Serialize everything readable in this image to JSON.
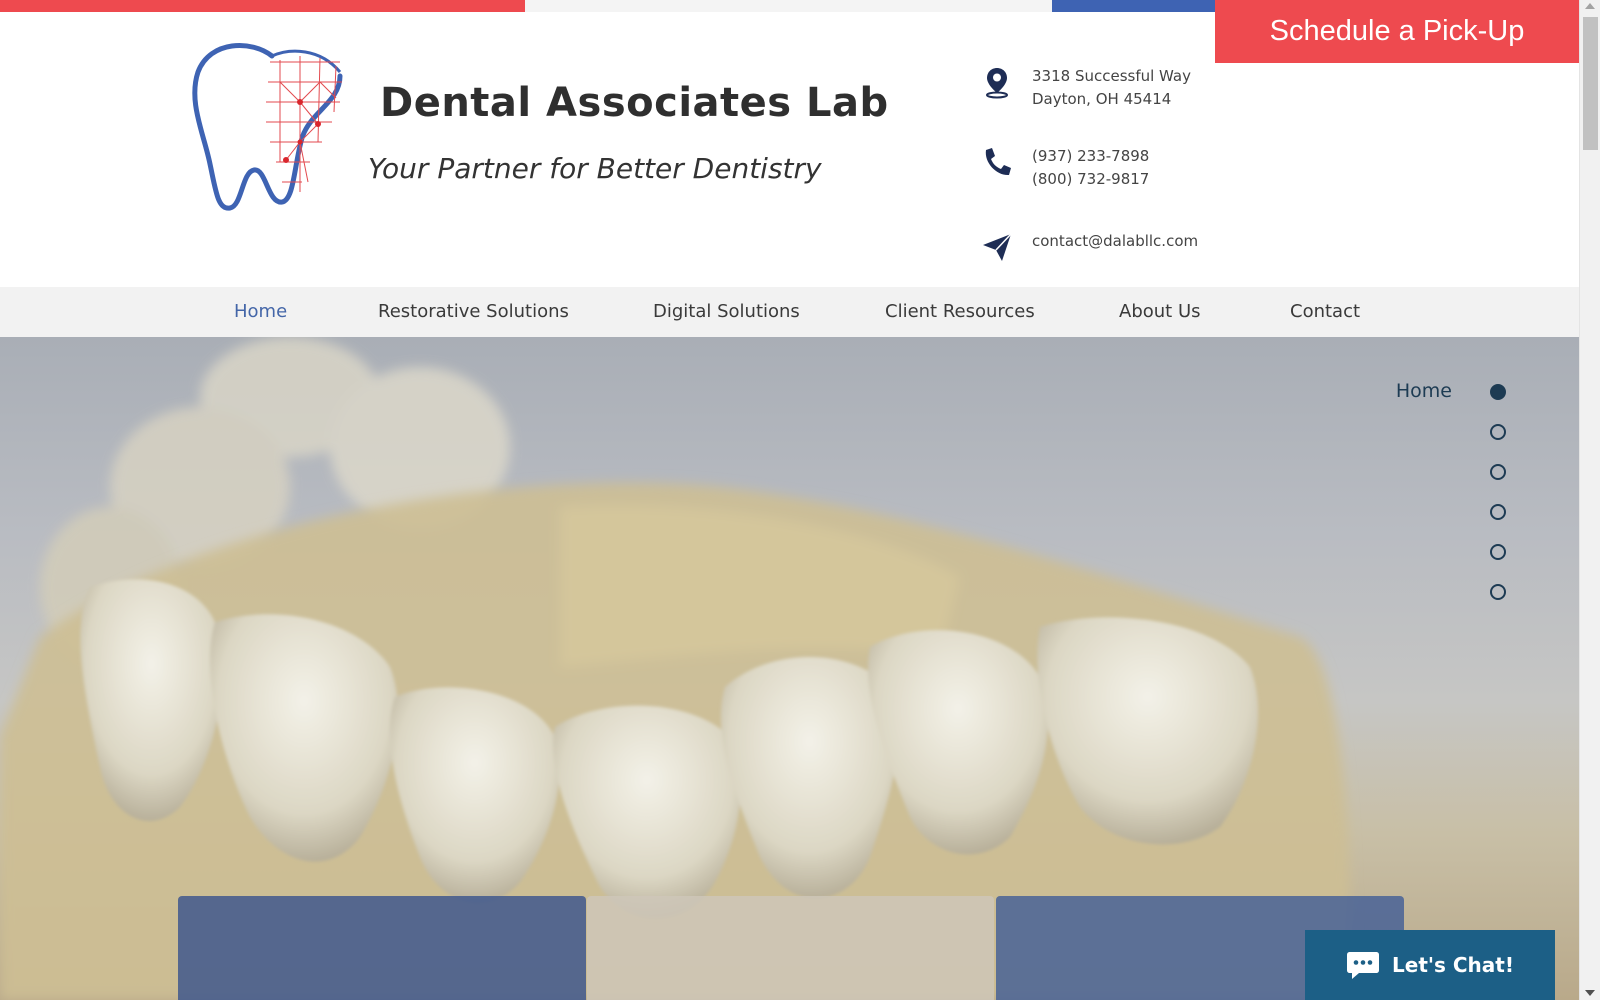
{
  "topbar": {
    "schedule_label": "Schedule a Pick-Up"
  },
  "brand": {
    "title": "Dental Associates Lab",
    "tagline": "Your Partner for Better Dentistry"
  },
  "contact": {
    "address_line1": "3318 Successful Way",
    "address_line2": "Dayton, OH 45414",
    "phone1": "(937) 233-7898",
    "phone2": "(800) 732-9817",
    "email": "contact@dalabllc.com"
  },
  "nav": {
    "items": [
      {
        "label": "Home",
        "active": true
      },
      {
        "label": "Restorative Solutions"
      },
      {
        "label": "Digital Solutions"
      },
      {
        "label": "Client Resources"
      },
      {
        "label": "About Us"
      },
      {
        "label": "Contact"
      }
    ]
  },
  "section_nav": {
    "active_label": "Home",
    "dot_count": 6
  },
  "chat": {
    "label": "Let's Chat!"
  },
  "colors": {
    "accent_red": "#ee4a4f",
    "accent_blue": "#3e63b3",
    "nav_active": "#4466a8",
    "chat_bg": "#1c5f86",
    "dot_color": "#1d3b53"
  },
  "icons": [
    "tooth-logo-icon",
    "location-pin-icon",
    "phone-icon",
    "paper-plane-icon",
    "chat-bubble-icon"
  ]
}
